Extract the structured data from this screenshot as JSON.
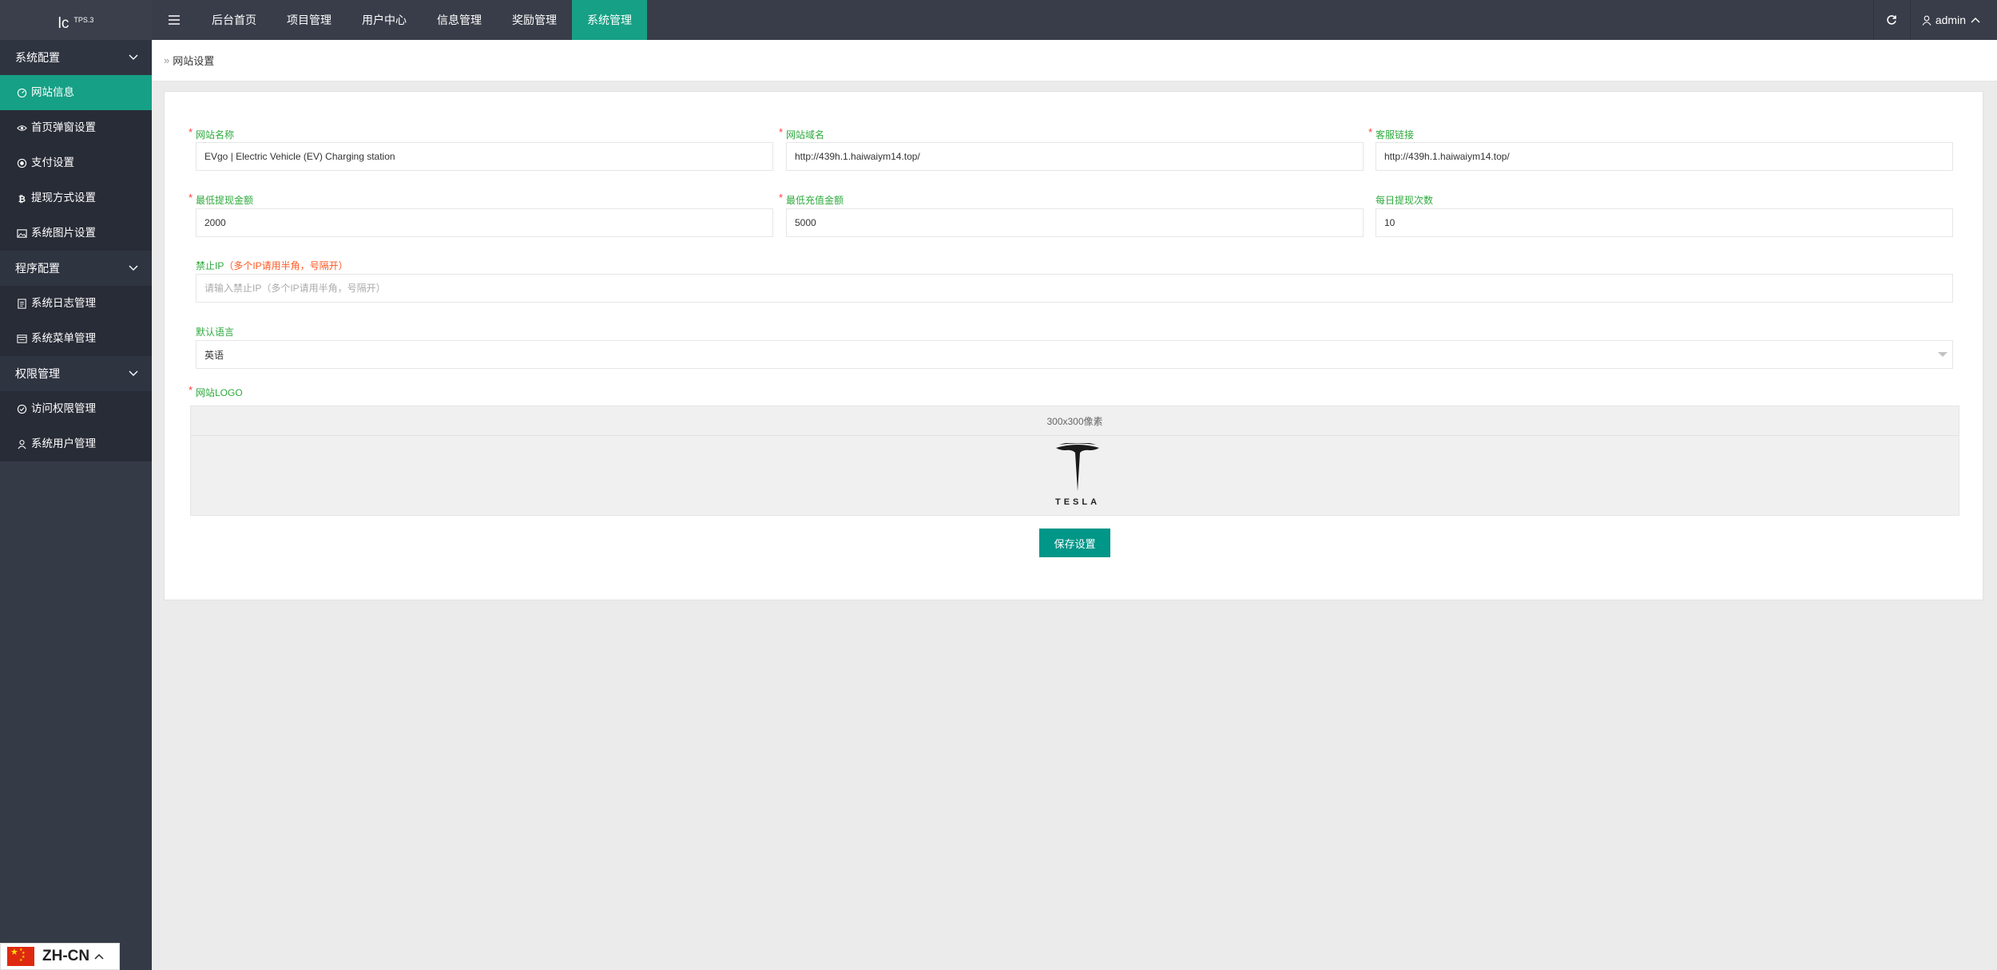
{
  "app": {
    "logo_text": "lc",
    "logo_sup": "TPS.3"
  },
  "topnav": {
    "items": [
      {
        "label": "后台首页",
        "active": false
      },
      {
        "label": "项目管理",
        "active": false
      },
      {
        "label": "用户中心",
        "active": false
      },
      {
        "label": "信息管理",
        "active": false
      },
      {
        "label": "奖励管理",
        "active": false
      },
      {
        "label": "系统管理",
        "active": true
      }
    ],
    "user": "admin"
  },
  "sidebar": {
    "groups": [
      {
        "label": "系统配置",
        "items": [
          {
            "label": "网站信息",
            "icon": "dashboard-icon",
            "active": true
          },
          {
            "label": "首页弹窗设置",
            "icon": "eye-icon",
            "active": false
          },
          {
            "label": "支付设置",
            "icon": "radio-icon",
            "active": false
          },
          {
            "label": "提现方式设置",
            "icon": "bitcoin-icon",
            "active": false
          },
          {
            "label": "系统图片设置",
            "icon": "image-icon",
            "active": false
          }
        ]
      },
      {
        "label": "程序配置",
        "items": [
          {
            "label": "系统日志管理",
            "icon": "log-icon",
            "active": false
          },
          {
            "label": "系统菜单管理",
            "icon": "menu-icon",
            "active": false
          }
        ]
      },
      {
        "label": "权限管理",
        "items": [
          {
            "label": "访问权限管理",
            "icon": "shield-check-icon",
            "active": false
          },
          {
            "label": "系统用户管理",
            "icon": "user-icon",
            "active": false
          }
        ]
      }
    ]
  },
  "breadcrumb": {
    "label": "网站设置"
  },
  "form": {
    "site_name": {
      "label": "网站名称",
      "value": "EVgo | Electric Vehicle (EV) Charging station",
      "required": true
    },
    "site_domain": {
      "label": "网站域名",
      "value": "http://439h.1.haiwaiym14.top/",
      "required": true
    },
    "service_link": {
      "label": "客服链接",
      "value": "http://439h.1.haiwaiym14.top/",
      "required": true
    },
    "min_withdraw": {
      "label": "最低提现金额",
      "value": "2000",
      "required": true
    },
    "min_recharge": {
      "label": "最低充值金额",
      "value": "5000",
      "required": true
    },
    "daily_withdraw": {
      "label": "每日提现次数",
      "value": "10",
      "required": false
    },
    "banned_ip": {
      "label": "禁止IP",
      "hint": "（多个IP请用半角，号隔开）",
      "placeholder": "请输入禁止IP（多个IP请用半角，号隔开）"
    },
    "language": {
      "label": "默认语言",
      "value": "英语"
    },
    "logo": {
      "label": "网站LOGO",
      "size_hint": "300x300像素",
      "logo_word": "TESLA",
      "required": true
    },
    "save_label": "保存设置"
  },
  "language_badge": {
    "label": "ZH-CN"
  },
  "colors": {
    "accent": "#16a085",
    "button": "#009688",
    "sidebar": "#353a47",
    "label": "#2eaa3d",
    "required": "#ff3b3b"
  }
}
